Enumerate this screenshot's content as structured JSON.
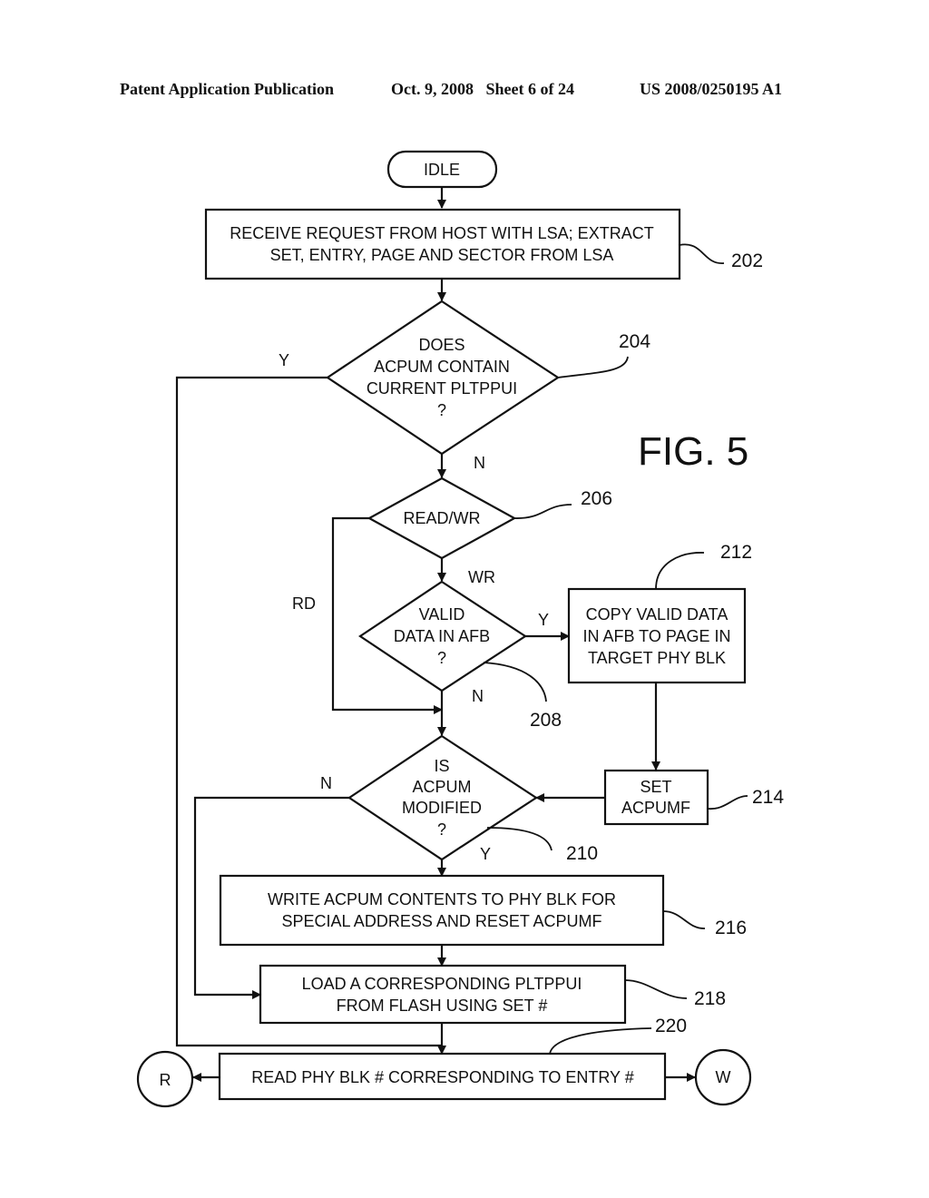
{
  "header": {
    "publication": "Patent Application Publication",
    "date_sheet": "Oct. 9, 2008   Sheet 6 of 24",
    "number": "US 2008/0250195 A1"
  },
  "figure_label": "FIG. 5",
  "nodes": {
    "idle": {
      "lines": [
        "IDLE"
      ]
    },
    "n202": {
      "ref": "202",
      "lines": [
        "RECEIVE REQUEST FROM HOST WITH LSA; EXTRACT",
        "SET, ENTRY, PAGE AND SECTOR FROM LSA"
      ]
    },
    "n204": {
      "ref": "204",
      "lines": [
        "DOES",
        "ACPUM CONTAIN",
        "CURRENT PLTPPUI",
        "?"
      ]
    },
    "n206": {
      "ref": "206",
      "lines": [
        "READ/WR"
      ]
    },
    "n208": {
      "ref": "208",
      "lines": [
        "VALID",
        "DATA IN AFB",
        "?"
      ]
    },
    "n212": {
      "ref": "212",
      "lines": [
        "COPY VALID DATA",
        "IN AFB TO PAGE IN",
        "TARGET PHY BLK"
      ]
    },
    "n214": {
      "ref": "214",
      "lines": [
        "SET",
        "ACPUMF"
      ]
    },
    "n210": {
      "ref": "210",
      "lines": [
        "IS",
        "ACPUM",
        "MODIFIED",
        "?"
      ]
    },
    "n216": {
      "ref": "216",
      "lines": [
        "WRITE ACPUM CONTENTS TO PHY BLK FOR",
        "SPECIAL ADDRESS AND RESET ACPUMF"
      ]
    },
    "n218": {
      "ref": "218",
      "lines": [
        "LOAD A CORRESPONDING PLTPPUI",
        "FROM FLASH USING SET #"
      ]
    },
    "n220": {
      "ref": "220",
      "lines": [
        "READ PHY BLK # CORRESPONDING TO ENTRY #"
      ]
    },
    "conn_r": {
      "lines": [
        "R"
      ]
    },
    "conn_w": {
      "lines": [
        "W"
      ]
    }
  },
  "branch_labels": {
    "n204_yes": "Y",
    "n204_no": "N",
    "n206_wr": "WR",
    "n206_rd": "RD",
    "n208_yes": "Y",
    "n208_no": "N",
    "n210_no": "N",
    "n210_yes": "Y"
  }
}
